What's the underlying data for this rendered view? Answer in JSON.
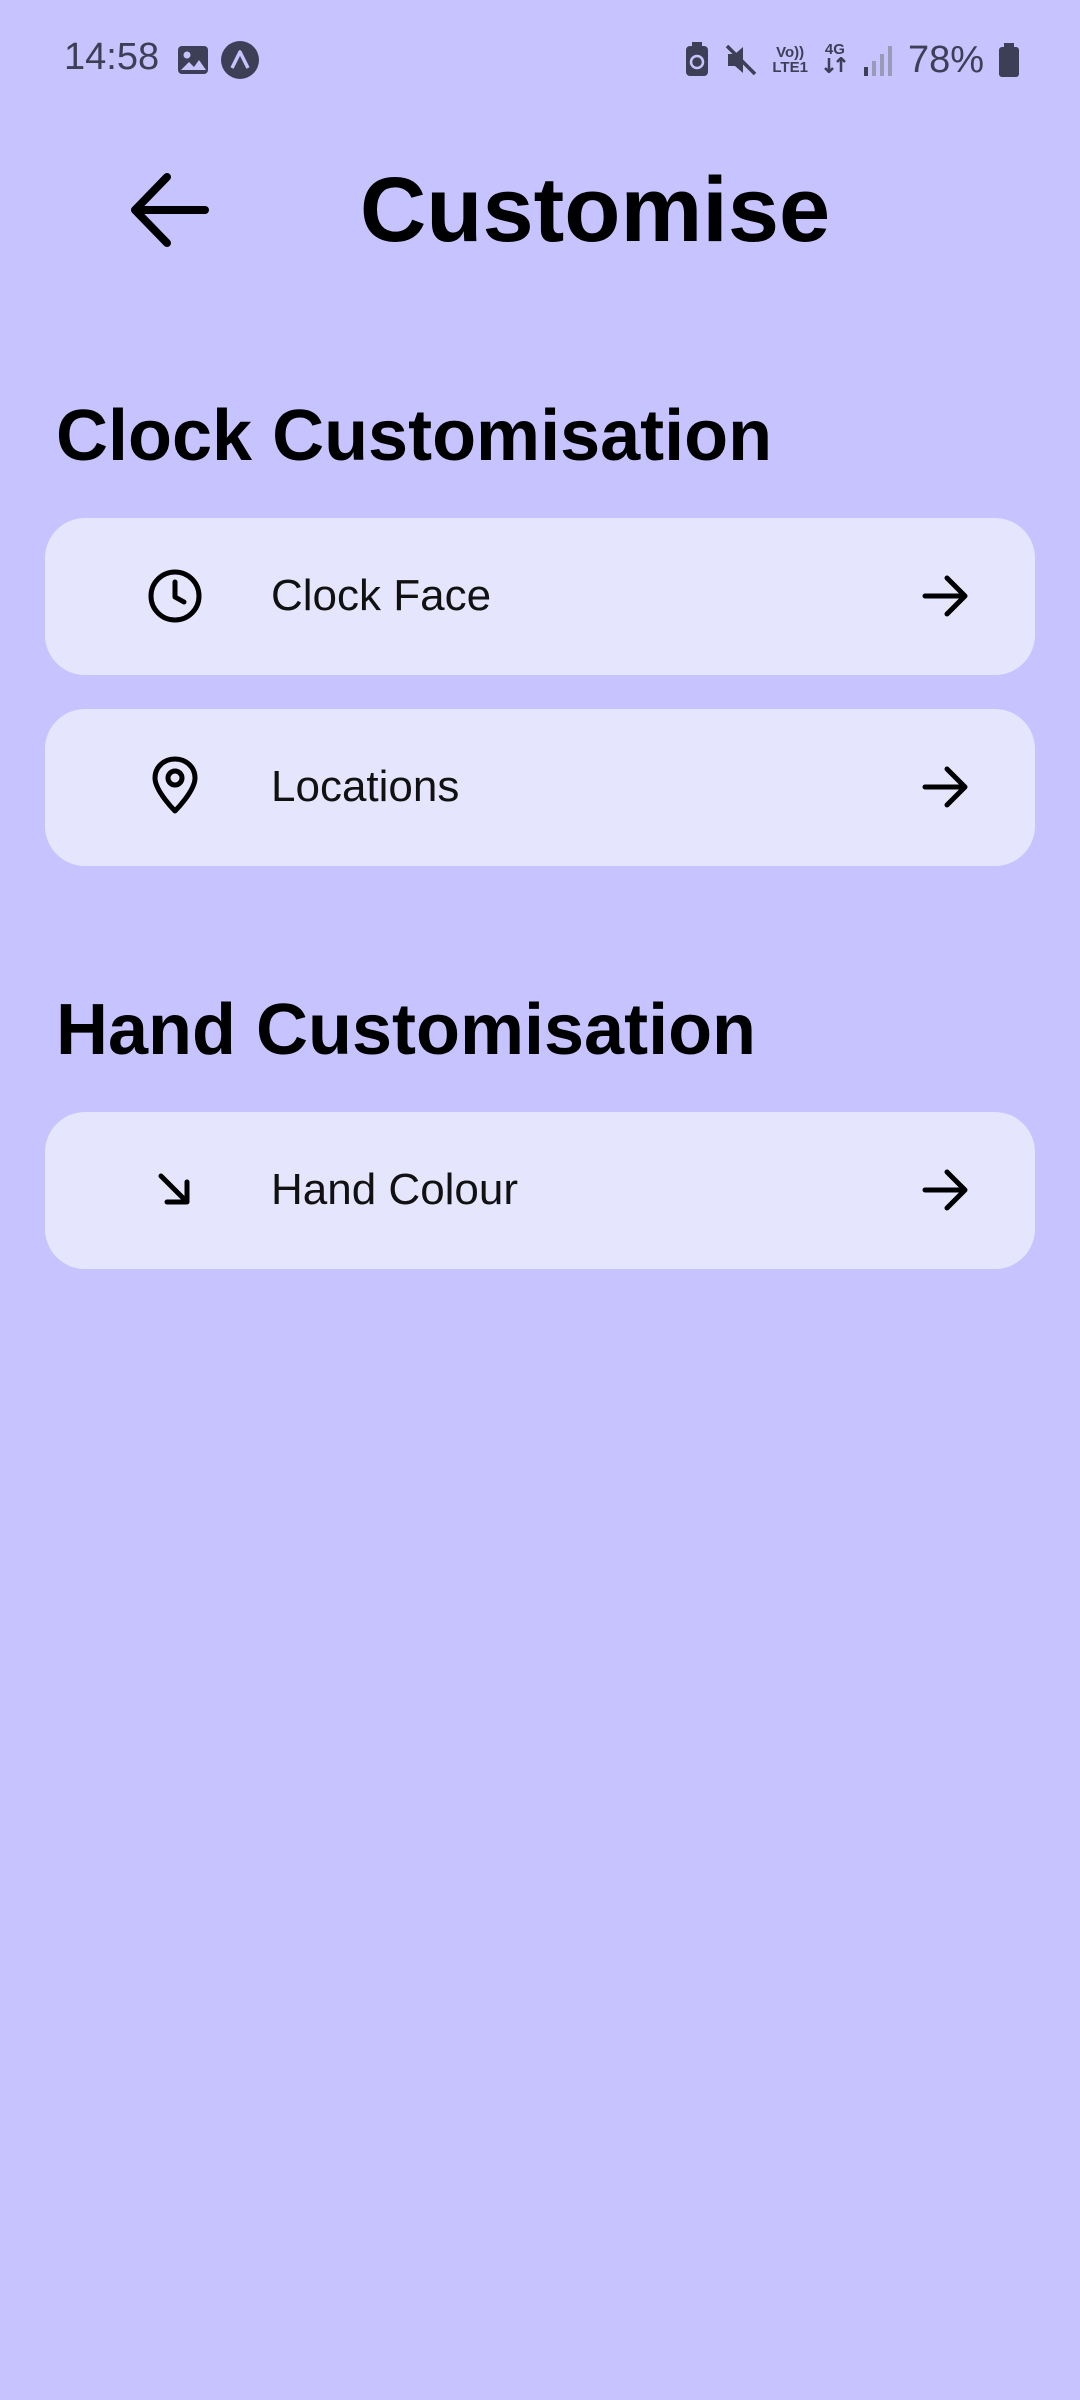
{
  "status_bar": {
    "time": "14:58",
    "battery": "78%",
    "network_top": "Vo))",
    "network_bottom": "LTE1",
    "data_type": "4G",
    "icons": [
      "gallery-icon",
      "app-notification-icon",
      "battery-saver-icon",
      "mute-icon",
      "volte-icon",
      "4g-data-icon",
      "signal-icon",
      "battery-icon"
    ]
  },
  "header": {
    "title": "Customise",
    "back_icon": "arrow-left-icon"
  },
  "sections": [
    {
      "title": "Clock Customisation",
      "items": [
        {
          "label": "Clock Face",
          "icon": "clock-icon",
          "trailing_icon": "arrow-right-icon"
        },
        {
          "label": "Locations",
          "icon": "map-pin-icon",
          "trailing_icon": "arrow-right-icon"
        }
      ]
    },
    {
      "title": "Hand Customisation",
      "items": [
        {
          "label": "Hand Colour",
          "icon": "arrow-down-right-icon",
          "trailing_icon": "arrow-right-icon"
        }
      ]
    }
  ],
  "colors": {
    "background": "#c6c3ff",
    "card": "#e6e5fe",
    "text": "#000000",
    "status_text": "#3c3f55"
  }
}
